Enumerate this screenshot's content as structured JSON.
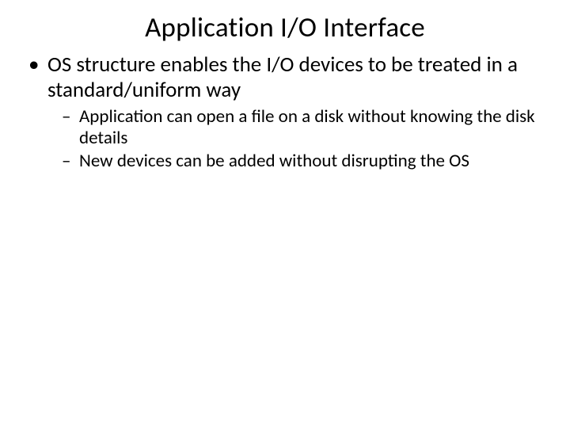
{
  "title": "Application I/O Interface",
  "bullets": {
    "l1_0": "OS structure enables the I/O devices to be treated in a standard/uniform way",
    "l2_0": "Application can  open a file on a disk without knowing the disk details",
    "l2_1": "New devices can be added without disrupting the OS"
  }
}
